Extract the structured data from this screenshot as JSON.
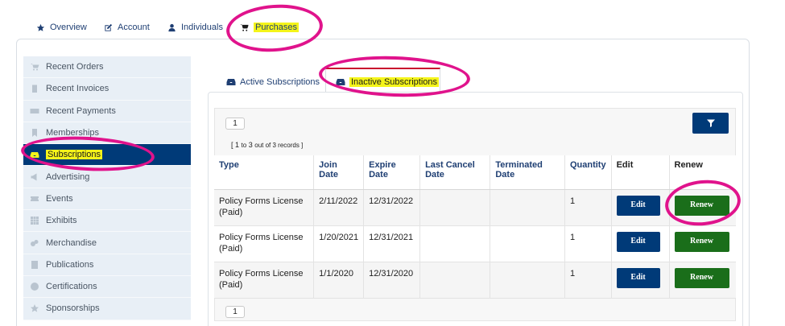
{
  "top_tabs": [
    {
      "label": "Overview",
      "icon": "star-icon"
    },
    {
      "label": "Account",
      "icon": "edit-icon"
    },
    {
      "label": "Individuals",
      "icon": "user-icon"
    },
    {
      "label": "Purchases",
      "icon": "cart-icon"
    }
  ],
  "sidebar": {
    "items": [
      {
        "label": "Recent Orders",
        "icon": "cart-icon"
      },
      {
        "label": "Recent Invoices",
        "icon": "clipboard-icon"
      },
      {
        "label": "Recent Payments",
        "icon": "money-icon"
      },
      {
        "label": "Memberships",
        "icon": "bookmark-icon"
      },
      {
        "label": "Subscriptions",
        "icon": "inbox-icon"
      },
      {
        "label": "Advertising",
        "icon": "bullhorn-icon"
      },
      {
        "label": "Events",
        "icon": "ticket-icon"
      },
      {
        "label": "Exhibits",
        "icon": "grid-icon"
      },
      {
        "label": "Merchandise",
        "icon": "cube-icon"
      },
      {
        "label": "Publications",
        "icon": "book-icon"
      },
      {
        "label": "Certifications",
        "icon": "certificate-icon"
      },
      {
        "label": "Sponsorships",
        "icon": "star-icon"
      }
    ],
    "active": "Subscriptions"
  },
  "sub_tabs": [
    {
      "label": "Active Subscriptions",
      "icon": "inbox-icon"
    },
    {
      "label": "Inactive Subscriptions",
      "icon": "inbox-icon"
    }
  ],
  "pager": {
    "page": "1",
    "records_prefix": "[ 1",
    "records_mid": "to",
    "records_count": "3",
    "records_suffix": "out of 3 records ]"
  },
  "table": {
    "headers": {
      "type": "Type",
      "join_date": "Join Date",
      "expire_date": "Expire Date",
      "last_cancel_date": "Last Cancel Date",
      "terminated_date": "Terminated Date",
      "quantity": "Quantity",
      "edit": "Edit",
      "renew": "Renew"
    },
    "rows": [
      {
        "type": "Policy Forms License (Paid)",
        "join": "2/11/2022",
        "expire": "12/31/2022",
        "cancel": "",
        "terminated": "",
        "quantity": "1",
        "edit": "Edit",
        "renew": "Renew"
      },
      {
        "type": "Policy Forms License (Paid)",
        "join": "1/20/2021",
        "expire": "12/31/2021",
        "cancel": "",
        "terminated": "",
        "quantity": "1",
        "edit": "Edit",
        "renew": "Renew"
      },
      {
        "type": "Policy Forms License (Paid)",
        "join": "1/1/2020",
        "expire": "12/31/2020",
        "cancel": "",
        "terminated": "",
        "quantity": "1",
        "edit": "Edit",
        "renew": "Renew"
      }
    ]
  },
  "colors": {
    "primary": "#003a78",
    "renew": "#1a6e1a",
    "highlight": "#f4f41a",
    "annotation": "#e0138c"
  }
}
